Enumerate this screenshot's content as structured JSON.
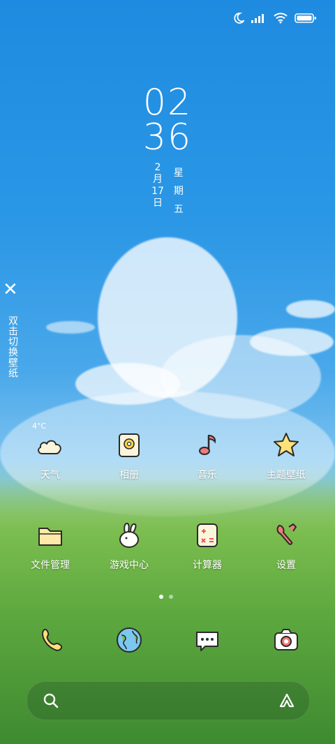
{
  "status_bar": {
    "icons": [
      "moon-icon",
      "signal-icon",
      "wifi-icon",
      "battery-icon"
    ]
  },
  "clock": {
    "hour": "02",
    "minute": "36"
  },
  "date": {
    "month_day": [
      "2",
      "月",
      "17",
      "日"
    ],
    "weekday": [
      "星",
      "期",
      "五"
    ]
  },
  "wallpaper": {
    "close_glyph": "✕",
    "hint": "双击切换壁纸"
  },
  "weather": {
    "temp": "4°C"
  },
  "apps": [
    {
      "label": "天气",
      "icon": "cloud-icon"
    },
    {
      "label": "相册",
      "icon": "gallery-icon"
    },
    {
      "label": "音乐",
      "icon": "music-note-icon"
    },
    {
      "label": "主题壁纸",
      "icon": "star-icon"
    },
    {
      "label": "文件管理",
      "icon": "folder-icon"
    },
    {
      "label": "游戏中心",
      "icon": "bunny-icon"
    },
    {
      "label": "计算器",
      "icon": "calculator-icon"
    },
    {
      "label": "设置",
      "icon": "wrench-icon"
    }
  ],
  "pager": {
    "count": 2,
    "active": 0
  },
  "dock": [
    {
      "icon": "phone-icon"
    },
    {
      "icon": "browser-globe-icon"
    },
    {
      "icon": "messages-icon"
    },
    {
      "icon": "camera-icon"
    }
  ],
  "search": {
    "icons": [
      "search-icon",
      "assistant-icon"
    ]
  },
  "colors": {
    "sky": "#2b97e6",
    "grass": "#5ea93f",
    "icon_fill": "#fbf5dc",
    "icon_stroke": "#2a2a2a"
  }
}
